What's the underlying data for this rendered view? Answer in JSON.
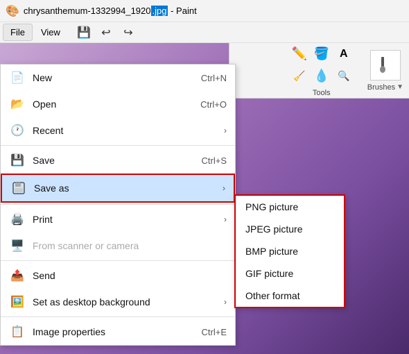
{
  "titleBar": {
    "icon": "🎨",
    "filename": "chrysanthemum-1332994_1920",
    "extension": ".jpg",
    "appName": "Paint"
  },
  "menuBar": {
    "items": [
      {
        "label": "File",
        "active": true
      },
      {
        "label": "View",
        "active": false
      }
    ],
    "toolbarButtons": [
      {
        "name": "save-icon",
        "symbol": "💾"
      },
      {
        "name": "undo-icon",
        "symbol": "↩"
      },
      {
        "name": "redo-icon",
        "symbol": "↪"
      }
    ]
  },
  "ribbon": {
    "tools": {
      "label": "Tools",
      "icons": [
        "✏️",
        "🖌️",
        "A",
        "🧹",
        "💧",
        "🔍"
      ]
    },
    "brushes": {
      "label": "Brushes"
    }
  },
  "fileMenu": {
    "items": [
      {
        "id": "new",
        "icon": "📄",
        "label": "New",
        "shortcut": "Ctrl+N",
        "arrow": false,
        "disabled": false
      },
      {
        "id": "open",
        "icon": "📂",
        "label": "Open",
        "shortcut": "Ctrl+O",
        "arrow": false,
        "disabled": false
      },
      {
        "id": "recent",
        "icon": "🕐",
        "label": "Recent",
        "shortcut": "",
        "arrow": true,
        "disabled": false
      },
      {
        "id": "save",
        "icon": "💾",
        "label": "Save",
        "shortcut": "Ctrl+S",
        "arrow": false,
        "disabled": false
      },
      {
        "id": "save-as",
        "icon": "💾",
        "label": "Save as",
        "shortcut": "",
        "arrow": true,
        "disabled": false,
        "active": true
      },
      {
        "id": "print",
        "icon": "🖨️",
        "label": "Print",
        "shortcut": "",
        "arrow": true,
        "disabled": false
      },
      {
        "id": "from-scanner",
        "icon": "🖥️",
        "label": "From scanner or camera",
        "shortcut": "",
        "arrow": false,
        "disabled": true
      },
      {
        "id": "send",
        "icon": "📤",
        "label": "Send",
        "shortcut": "",
        "arrow": false,
        "disabled": false
      },
      {
        "id": "set-desktop",
        "icon": "🖼️",
        "label": "Set as desktop background",
        "shortcut": "",
        "arrow": true,
        "disabled": false
      },
      {
        "id": "image-properties",
        "icon": "📋",
        "label": "Image properties",
        "shortcut": "Ctrl+E",
        "arrow": false,
        "disabled": false
      }
    ]
  },
  "saveAsSubmenu": {
    "items": [
      {
        "id": "png",
        "label": "PNG picture"
      },
      {
        "id": "jpeg",
        "label": "JPEG picture"
      },
      {
        "id": "bmp",
        "label": "BMP picture"
      },
      {
        "id": "gif",
        "label": "GIF picture"
      },
      {
        "id": "other",
        "label": "Other format"
      }
    ]
  }
}
